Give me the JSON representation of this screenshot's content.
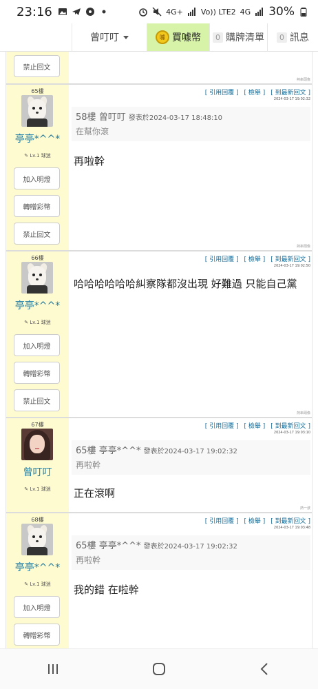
{
  "status": {
    "time": "23:16",
    "battery": "30%",
    "net_4g_1": "4G+",
    "net_4g_2": "4G",
    "lte": "Vo)) LTE2"
  },
  "nav": {
    "username": "曾叮叮",
    "buy_label": "買噱幣",
    "coin_text": "噱",
    "cart_count": "0",
    "cart_label": "購牌清單",
    "msg_count": "0",
    "msg_label": "訊息"
  },
  "posts": [
    {
      "side_buttons": [
        "禁止回文"
      ],
      "corner_tag": "熱串頭像"
    },
    {
      "floor": "65樓",
      "username": "亭亭*^^*",
      "level": "✎ Lv.1 球迷",
      "actions": [
        "[ 引用回覆 ]",
        "[ 檢舉 ]",
        "[ 到最新回文 ]"
      ],
      "time": "2024-03-17 19:02:32",
      "quote": {
        "floor": "58樓",
        "user": "曾叮叮",
        "meta": "發表於2024-03-17 18:48:10",
        "text": "在幫你滾"
      },
      "body": "再啦幹",
      "side_buttons": [
        "加入明燈",
        "轉贈彩幣",
        "禁止回文"
      ],
      "corner_tag": "熱串頭像"
    },
    {
      "floor": "66樓",
      "username": "亭亭*^^*",
      "level": "✎ Lv.1 球迷",
      "actions": [
        "[ 引用回覆 ]",
        "[ 檢舉 ]",
        "[ 到最新回文 ]"
      ],
      "time": "2024-03-17 19:02:50",
      "body": "哈哈哈哈哈哈糾察隊都沒出現 好難過 只能自己黨",
      "side_buttons": [
        "加入明燈",
        "轉贈彩幣",
        "禁止回文"
      ],
      "corner_tag": "熱串頭像"
    },
    {
      "floor": "67樓",
      "username": "曾叮叮",
      "level": "✎ Lv.1 球迷",
      "actions": [
        "[ 引用回覆 ]",
        "[ 檢舉 ]",
        "[ 到最新回文 ]"
      ],
      "time": "2024-03-17 19:03:10",
      "quote": {
        "floor": "65樓",
        "user": "亭亭*^^*",
        "meta": "發表於2024-03-17 19:02:32",
        "text": "再啦幹"
      },
      "body": "正在滾啊",
      "corner_tag": "熱一波"
    },
    {
      "floor": "68樓",
      "username": "亭亭*^^*",
      "level": "✎ Lv.1 球迷",
      "actions": [
        "[ 引用回覆 ]",
        "[ 檢舉 ]",
        "[ 到最新回文 ]"
      ],
      "time": "2024-03-17 19:03:48",
      "quote": {
        "floor": "65樓",
        "user": "亭亭*^^*",
        "meta": "發表於2024-03-17 19:02:32",
        "text": "再啦幹"
      },
      "body": "我的錯 在啦幹",
      "side_buttons": [
        "加入明燈",
        "轉贈彩幣"
      ]
    }
  ],
  "colors": {
    "sidebar_bg": "#fffbd0",
    "link": "#1a6f9a",
    "username": "#1c7ba3",
    "buy_bg": "#d7f3a7"
  },
  "icons": {
    "status": [
      "image-icon",
      "telegram-icon",
      "location-icon",
      "dot-icon",
      "alarm-icon",
      "mute-icon",
      "signal-icon",
      "battery-icon"
    ],
    "android_nav": [
      "recents-icon",
      "home-icon",
      "back-icon"
    ]
  }
}
